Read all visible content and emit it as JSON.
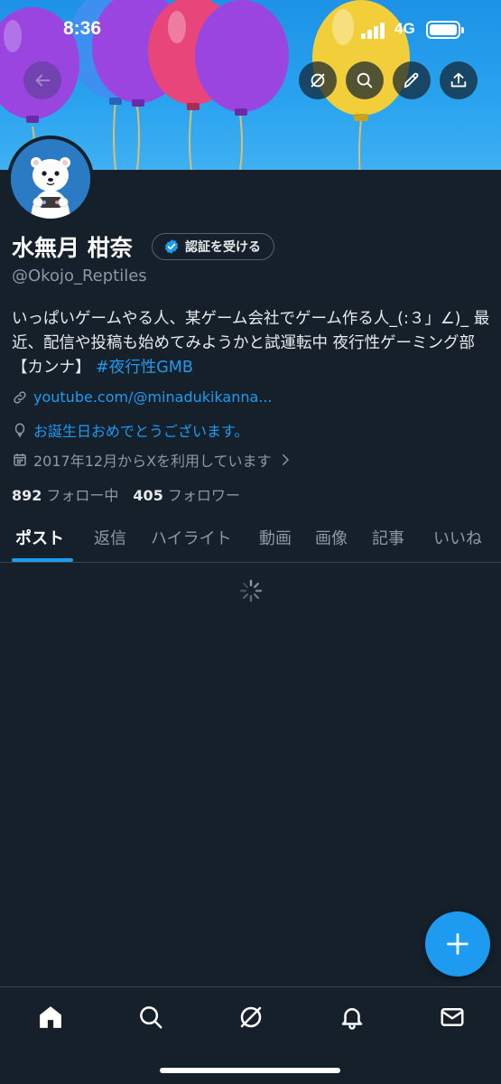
{
  "status_bar": {
    "time": "8:36",
    "network": "4G"
  },
  "profile": {
    "display_name": "水無月 柑奈",
    "verify_label": "認証を受ける",
    "handle": "@Okojo_Reptiles",
    "bio_text": "いっぱいゲームやる人、某ゲーム会社でゲーム作る人_(:３」∠)_ 最近、配信や投稿も始めてみようかと試運転中 夜行性ゲーミング部【カンナ】",
    "bio_hashtag": "#夜行性GMB",
    "website": "youtube.com/@minadukikanna...",
    "birthday": "お誕生日おめでとうございます。",
    "joined": "2017年12月からXを利用しています",
    "following_count": "892",
    "following_label": "フォロー中",
    "followers_count": "405",
    "followers_label": "フォロワー"
  },
  "tabs": [
    {
      "label": "ポスト",
      "active": true
    },
    {
      "label": "返信",
      "active": false
    },
    {
      "label": "ハイライト",
      "active": false
    },
    {
      "label": "動画",
      "active": false
    },
    {
      "label": "画像",
      "active": false
    },
    {
      "label": "記事",
      "active": false
    },
    {
      "label": "いいね",
      "active": false
    }
  ],
  "header_actions": {
    "back": "back-arrow-icon",
    "grok": "grok-icon",
    "search": "search-icon",
    "edit": "edit-pencil-icon",
    "share": "share-upload-icon"
  },
  "bottom_nav": [
    "home-icon",
    "search-icon",
    "grok-icon",
    "notifications-bell-icon",
    "messages-mail-icon"
  ],
  "colors": {
    "background": "#15202b",
    "accent": "#1d9bf0",
    "muted_text": "#8b98a5",
    "banner_sky": "#2aa3ef"
  }
}
